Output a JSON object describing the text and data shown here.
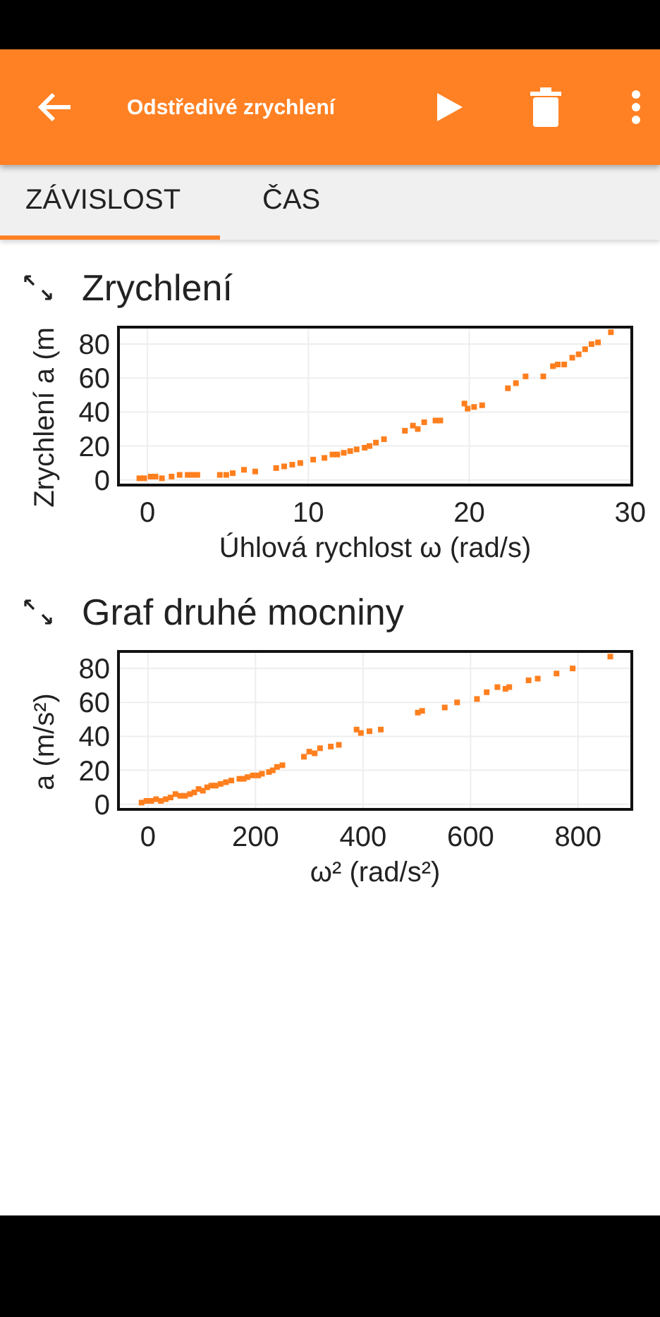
{
  "app_bar": {
    "title": "Odstředivé zrychlení"
  },
  "tabs": [
    {
      "label": "ZÁVISLOST",
      "selected": true
    },
    {
      "label": "ČAS",
      "selected": false
    }
  ],
  "graphs": [
    {
      "title": "Zrychlení",
      "chart_data": {
        "type": "scatter",
        "xlabel": "Úhlová rychlost ω (rad/s)",
        "ylabel": "Zrychlení a (m",
        "xlim": [
          -1.8,
          30.1
        ],
        "ylim": [
          -3,
          90
        ],
        "xticks": [
          0,
          10,
          20,
          30
        ],
        "grid": true,
        "yticks": [
          0,
          20,
          40,
          60,
          80
        ],
        "x": [
          -0.5,
          -0.2,
          0.2,
          0.5,
          0.9,
          1.5,
          2.0,
          2.5,
          2.8,
          3.1,
          4.5,
          4.9,
          5.3,
          6.0,
          6.7,
          8.0,
          8.5,
          9.0,
          9.5,
          10.3,
          11.0,
          11.5,
          11.8,
          12.2,
          12.6,
          13.0,
          13.5,
          13.8,
          14.2,
          14.7,
          16.0,
          16.5,
          16.8,
          17.2,
          17.9,
          18.2,
          19.7,
          19.9,
          20.3,
          20.8,
          22.4,
          22.9,
          23.5,
          24.6,
          25.2,
          25.5,
          25.9,
          26.4,
          26.8,
          27.2,
          27.6,
          28.0,
          28.8
        ],
        "series": [
          {
            "color": "#ff7f1e",
            "values": [
              1,
              1,
              2,
              2,
              1,
              2,
              3,
              3,
              3,
              3,
              3,
              3,
              4,
              6,
              5,
              7,
              8,
              9,
              10,
              12,
              13,
              15,
              15,
              16,
              17,
              18,
              19,
              20,
              22,
              24,
              29,
              32,
              30,
              34,
              35,
              35,
              45,
              42,
              43,
              44,
              54,
              57,
              61,
              61,
              67,
              68,
              68,
              72,
              74,
              77,
              80,
              81,
              87
            ]
          }
        ]
      }
    },
    {
      "title": "Graf druhé mocniny",
      "chart_data": {
        "type": "scatter",
        "xlabel": "ω² (rad/s²)",
        "ylabel": "a (m/s²)",
        "xlim": [
          -55,
          900
        ],
        "ylim": [
          -3,
          90
        ],
        "xticks": [
          0,
          200,
          400,
          600,
          800
        ],
        "grid": true,
        "yticks": [
          0,
          20,
          40,
          60,
          80
        ],
        "x": [
          -12,
          -3,
          6,
          15,
          24,
          33,
          42,
          51,
          60,
          69,
          78,
          86,
          94,
          102,
          110,
          118,
          126,
          135,
          145,
          155,
          170,
          178,
          185,
          195,
          205,
          212,
          225,
          232,
          240,
          250,
          290,
          300,
          310,
          320,
          340,
          355,
          388,
          396,
          412,
          433,
          502,
          510,
          552,
          575,
          612,
          630,
          650,
          665,
          672,
          708,
          725,
          760,
          790,
          860
        ],
        "series": [
          {
            "color": "#ff7f1e",
            "values": [
              1,
              2,
              2,
              3,
              2,
              3,
              4,
              6,
              5,
              5,
              6,
              7,
              9,
              8,
              10,
              11,
              11,
              12,
              13,
              14,
              15,
              15,
              16,
              17,
              17,
              18,
              19,
              20,
              22,
              23,
              28,
              31,
              30,
              33,
              34,
              35,
              44,
              42,
              43,
              44,
              54,
              55,
              57,
              60,
              62,
              66,
              69,
              68,
              69,
              73,
              74,
              77,
              80,
              87
            ]
          }
        ]
      }
    }
  ]
}
